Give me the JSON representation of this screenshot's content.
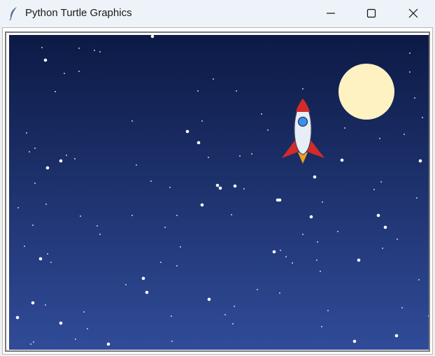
{
  "window": {
    "title": "Python Turtle Graphics",
    "app_icon": "feather-icon",
    "controls": [
      "minimize-icon",
      "maximize-icon",
      "close-icon"
    ]
  },
  "scene": {
    "description_colors": {
      "sky_top": "#0c1a45",
      "sky_bottom": "#304b98",
      "moon": "#fff2c2",
      "star": "#ffffff",
      "rocket_body": "#e8eef5",
      "rocket_outline": "#3c4b63",
      "rocket_nose": "#d22b2b",
      "rocket_fins": "#d22b2b",
      "rocket_window": "#3a8ff0",
      "rocket_flame": "#f0a020"
    }
  }
}
